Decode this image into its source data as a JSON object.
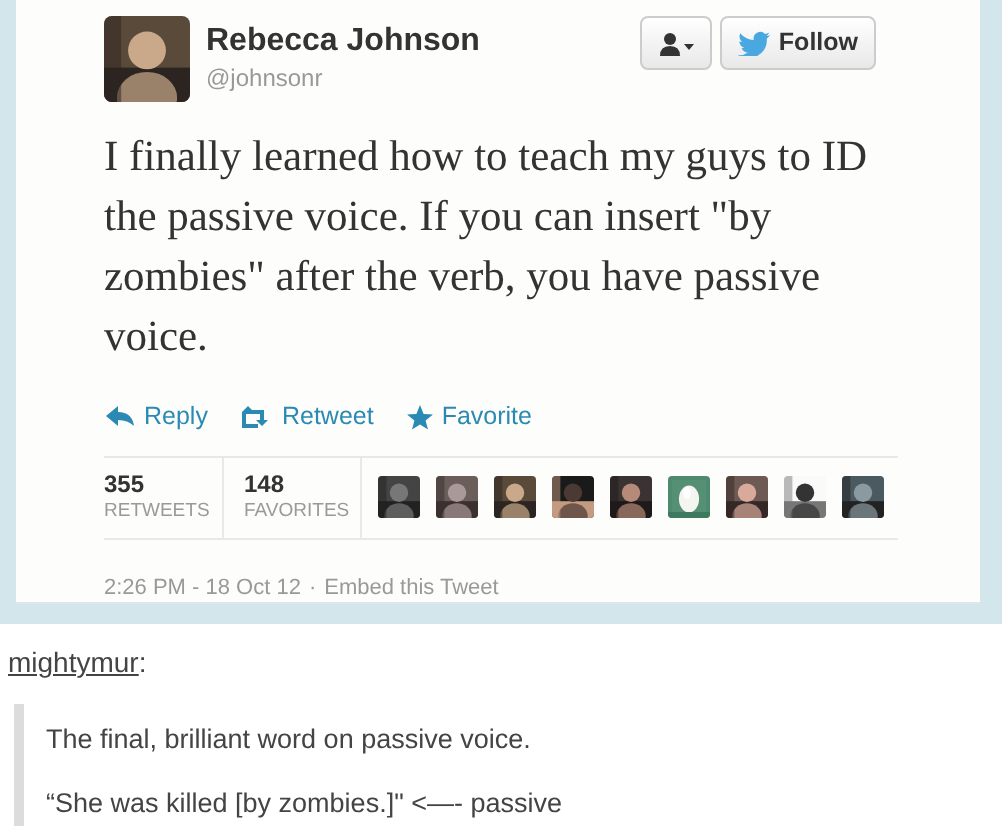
{
  "tweet": {
    "author": "Rebecca Johnson",
    "handle": "@johnsonr",
    "follow_label": "Follow",
    "text": "I finally learned how to teach my guys to ID the passive voice. If you can insert \"by zombies\" after the verb, you have passive voice.",
    "actions": [
      {
        "kind": "reply",
        "label": "Reply"
      },
      {
        "kind": "retweet",
        "label": "Retweet"
      },
      {
        "kind": "favorite",
        "label": "Favorite"
      }
    ],
    "stats": [
      {
        "count": "355",
        "label": "RETWEETS"
      },
      {
        "count": "148",
        "label": "FAVORITES"
      }
    ],
    "favoriters": [
      {
        "kind": "picture"
      },
      {
        "kind": "picture"
      },
      {
        "kind": "picture"
      },
      {
        "kind": "picture"
      },
      {
        "kind": "picture"
      },
      {
        "kind": "egg"
      },
      {
        "kind": "picture"
      },
      {
        "kind": "picture"
      },
      {
        "kind": "picture"
      }
    ],
    "timestamp": "2:26 PM - 18 Oct 12",
    "separator": "·",
    "embed_link": "Embed this Tweet"
  },
  "reblog": {
    "username": "mightymur",
    "colon": ":",
    "quote": [
      "The final, brilliant word on passive voice.",
      "“She was killed [by zombies.]\" <—- passive"
    ]
  }
}
